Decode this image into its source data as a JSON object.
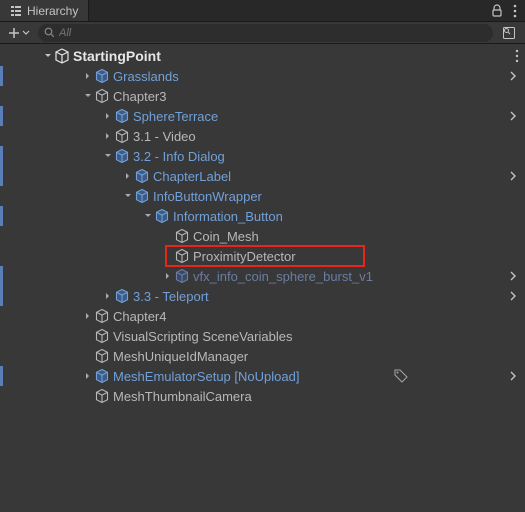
{
  "tab": {
    "title": "Hierarchy"
  },
  "search": {
    "placeholder": "All"
  },
  "scene": {
    "name": "StartingPoint",
    "rows": [
      {
        "id": "grasslands",
        "label": "Grasslands",
        "indent": 1,
        "prefab": true,
        "expand": "closed",
        "bar": true,
        "arrow": true
      },
      {
        "id": "chapter3",
        "label": "Chapter3",
        "indent": 1,
        "prefab": false,
        "expand": "open",
        "bar": false,
        "arrow": false
      },
      {
        "id": "sphereterrace",
        "label": "SphereTerrace",
        "indent": 2,
        "prefab": true,
        "expand": "closed",
        "bar": true,
        "arrow": true
      },
      {
        "id": "video",
        "label": "3.1 - Video",
        "indent": 2,
        "prefab": false,
        "expand": "closed",
        "bar": false,
        "arrow": false
      },
      {
        "id": "infodialog",
        "label": "3.2 - Info Dialog",
        "indent": 2,
        "prefab": true,
        "expand": "open",
        "bar": true,
        "arrow": false
      },
      {
        "id": "chapterlabel",
        "label": "ChapterLabel",
        "indent": 3,
        "prefab": true,
        "expand": "closed",
        "bar": true,
        "arrow": true
      },
      {
        "id": "infobuttonwrapper",
        "label": "InfoButtonWrapper",
        "indent": 3,
        "prefab": true,
        "expand": "open",
        "bar": false,
        "arrow": false
      },
      {
        "id": "informationbutton",
        "label": "Information_Button",
        "indent": 4,
        "prefab": true,
        "expand": "open",
        "bar": true,
        "arrow": false
      },
      {
        "id": "coinmesh",
        "label": "Coin_Mesh",
        "indent": 5,
        "prefab": false,
        "expand": "none",
        "bar": false,
        "arrow": false
      },
      {
        "id": "proximitydetector",
        "label": "ProximityDetector",
        "indent": 5,
        "prefab": false,
        "expand": "none",
        "bar": false,
        "arrow": false,
        "highlight": true
      },
      {
        "id": "vfxcoin",
        "label": "vfx_info_coin_sphere_burst_v1",
        "indent": 5,
        "prefab": true,
        "faded": true,
        "expand": "closed",
        "bar": true,
        "arrow": true
      },
      {
        "id": "teleport",
        "label": "3.3 - Teleport",
        "indent": 2,
        "prefab": true,
        "expand": "closed",
        "bar": true,
        "arrow": true
      },
      {
        "id": "chapter4",
        "label": "Chapter4",
        "indent": 1,
        "prefab": false,
        "expand": "closed",
        "bar": false,
        "arrow": false
      },
      {
        "id": "vsv",
        "label": "VisualScripting SceneVariables",
        "indent": 1,
        "prefab": false,
        "expand": "none",
        "bar": false,
        "arrow": false
      },
      {
        "id": "muid",
        "label": "MeshUniqueIdManager",
        "indent": 1,
        "prefab": false,
        "expand": "none",
        "bar": false,
        "arrow": false
      },
      {
        "id": "emulator",
        "label": "MeshEmulatorSetup [NoUpload]",
        "indent": 1,
        "prefab": true,
        "expand": "closed",
        "bar": true,
        "arrow": true,
        "tag": true
      },
      {
        "id": "thumb",
        "label": "MeshThumbnailCamera",
        "indent": 1,
        "prefab": false,
        "expand": "none",
        "bar": false,
        "arrow": false
      }
    ]
  }
}
